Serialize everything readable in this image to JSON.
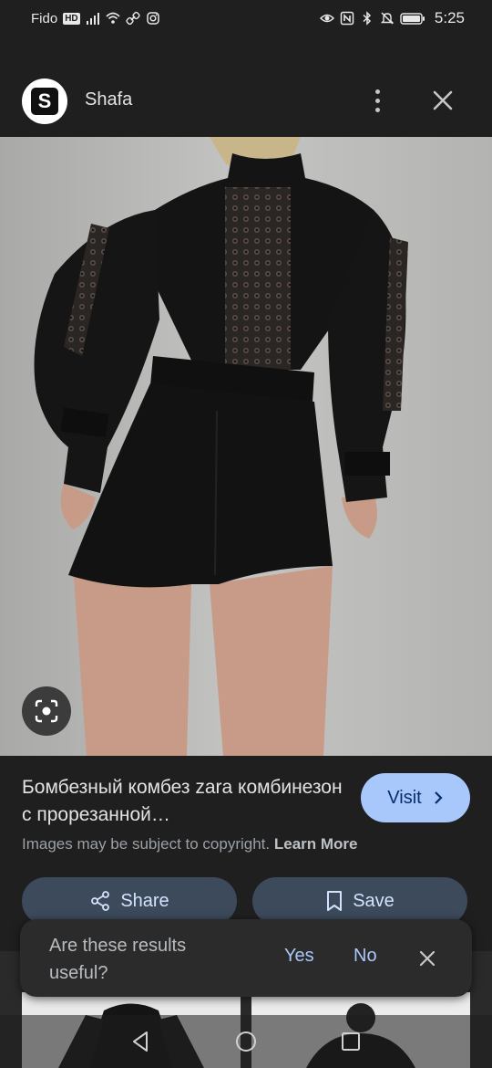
{
  "status_bar": {
    "carrier": "Fido",
    "hd_badge": "HD",
    "time": "5:25",
    "icons": [
      "signal-icon",
      "wifi-icon",
      "link-icon",
      "instagram-icon",
      "eye-icon",
      "nfc-icon",
      "bluetooth-icon",
      "mute-icon",
      "battery-icon"
    ]
  },
  "header": {
    "logo_letter": "S",
    "site_name": "Shafa",
    "icons": [
      "more-vert-icon",
      "close-icon"
    ]
  },
  "image": {
    "description_icon": "lens-icon"
  },
  "result": {
    "title": "Бомбезный комбез zara комбинезон с прорезанной…",
    "visit_label": "Visit",
    "copyright_text": "Images may be subject to copyright. ",
    "learn_more": "Learn More",
    "share_label": "Share",
    "save_label": "Save"
  },
  "feedback": {
    "question": "Are these results useful?",
    "yes": "Yes",
    "no": "No"
  },
  "colors": {
    "background": "#1f1f1f",
    "visit_button": "#a8c7fa",
    "action_button": "#3c4a5c",
    "link_blue": "#a8c7fa"
  }
}
